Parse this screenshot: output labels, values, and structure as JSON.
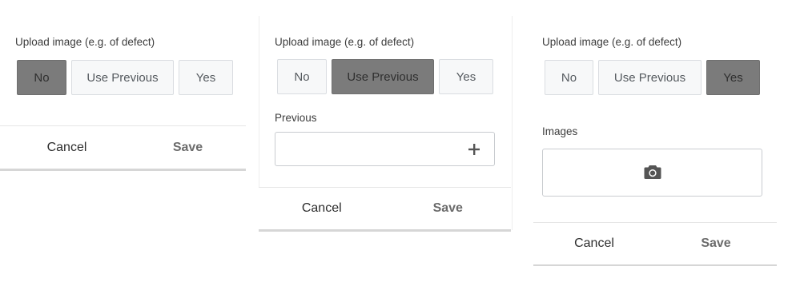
{
  "panels": [
    {
      "upload_label": "Upload image (e.g. of defect)",
      "options": [
        "No",
        "Use Previous",
        "Yes"
      ],
      "selected": "No",
      "cancel_label": "Cancel",
      "save_label": "Save"
    },
    {
      "upload_label": "Upload image (e.g. of defect)",
      "options": [
        "No",
        "Use Previous",
        "Yes"
      ],
      "selected": "Use Previous",
      "previous_label": "Previous",
      "add_icon": "plus-icon",
      "cancel_label": "Cancel",
      "save_label": "Save"
    },
    {
      "upload_label": "Upload image (e.g. of defect)",
      "options": [
        "No",
        "Use Previous",
        "Yes"
      ],
      "selected": "Yes",
      "images_label": "Images",
      "camera_icon": "camera-icon",
      "cancel_label": "Cancel",
      "save_label": "Save"
    }
  ],
  "colors": {
    "selected_bg": "#7b7b7b",
    "unselected_bg": "#f7f8f9",
    "border": "#dadde1"
  }
}
